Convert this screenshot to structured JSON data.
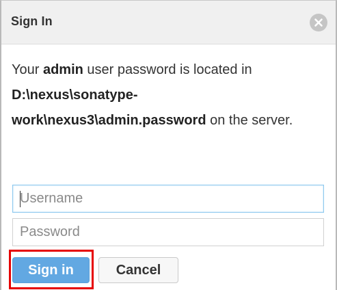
{
  "dialog": {
    "title": "Sign In",
    "close_icon": "close-circle-icon",
    "message": {
      "part1": "Your ",
      "user": "admin",
      "part2": " user password is located in ",
      "path_line1": "D:\\nexus\\sonatype-",
      "path_line2": "work\\nexus3\\admin.password",
      "part3": " on the server."
    },
    "username": {
      "value": "",
      "placeholder": "Username"
    },
    "password": {
      "value": "",
      "placeholder": "Password"
    },
    "sign_in_label": "Sign in",
    "cancel_label": "Cancel"
  },
  "colors": {
    "header_bg": "#f0f0f0",
    "primary_button": "#62a8e2",
    "focus_border": "#8cc9ee",
    "highlight": "#e60000"
  }
}
